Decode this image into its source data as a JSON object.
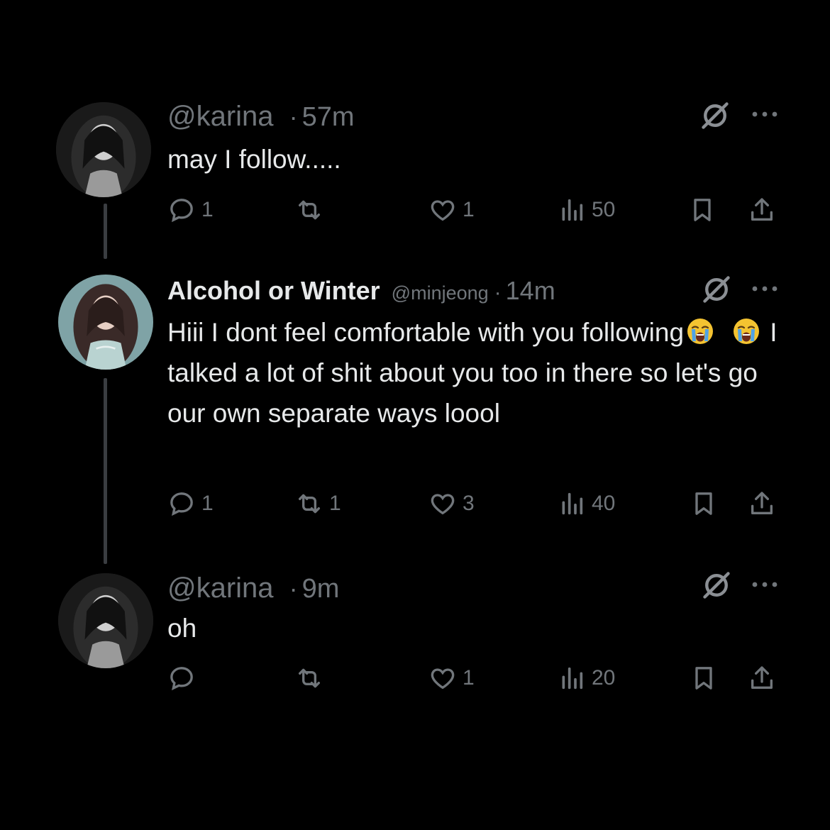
{
  "tweets": [
    {
      "display_name": "",
      "handle": "@karina",
      "separator": "·",
      "time": "57m",
      "text": "may I follow.....",
      "counts": {
        "replies": "1",
        "reposts": "",
        "likes": "1",
        "views": "50"
      }
    },
    {
      "display_name": "Alcohol or Winter",
      "handle": "@minjeong",
      "separator": "·",
      "time": "14m",
      "text_parts": {
        "part1": "Hiii I dont feel comfortable with you following",
        "part2": " I talked a lot of shit about you too in there so let's go our own separate ways loool"
      },
      "emoji": [
        "loudly-crying-face",
        "loudly-crying-face"
      ],
      "counts": {
        "replies": "1",
        "reposts": "1",
        "likes": "3",
        "views": "40"
      }
    },
    {
      "display_name": "",
      "handle": "@karina",
      "separator": "·",
      "time": "9m",
      "text": "oh",
      "counts": {
        "replies": "",
        "reposts": "",
        "likes": "1",
        "views": "20"
      }
    }
  ],
  "icons": {
    "reply": "reply-icon",
    "repost": "repost-icon",
    "like": "heart-icon",
    "views": "views-icon",
    "bookmark": "bookmark-icon",
    "share": "share-icon",
    "grok": "grok-icon",
    "more": "more-icon"
  },
  "colors": {
    "background": "#000000",
    "text": "#e7e9ea",
    "muted": "#71767b",
    "thread_line": "#3a3d41"
  }
}
